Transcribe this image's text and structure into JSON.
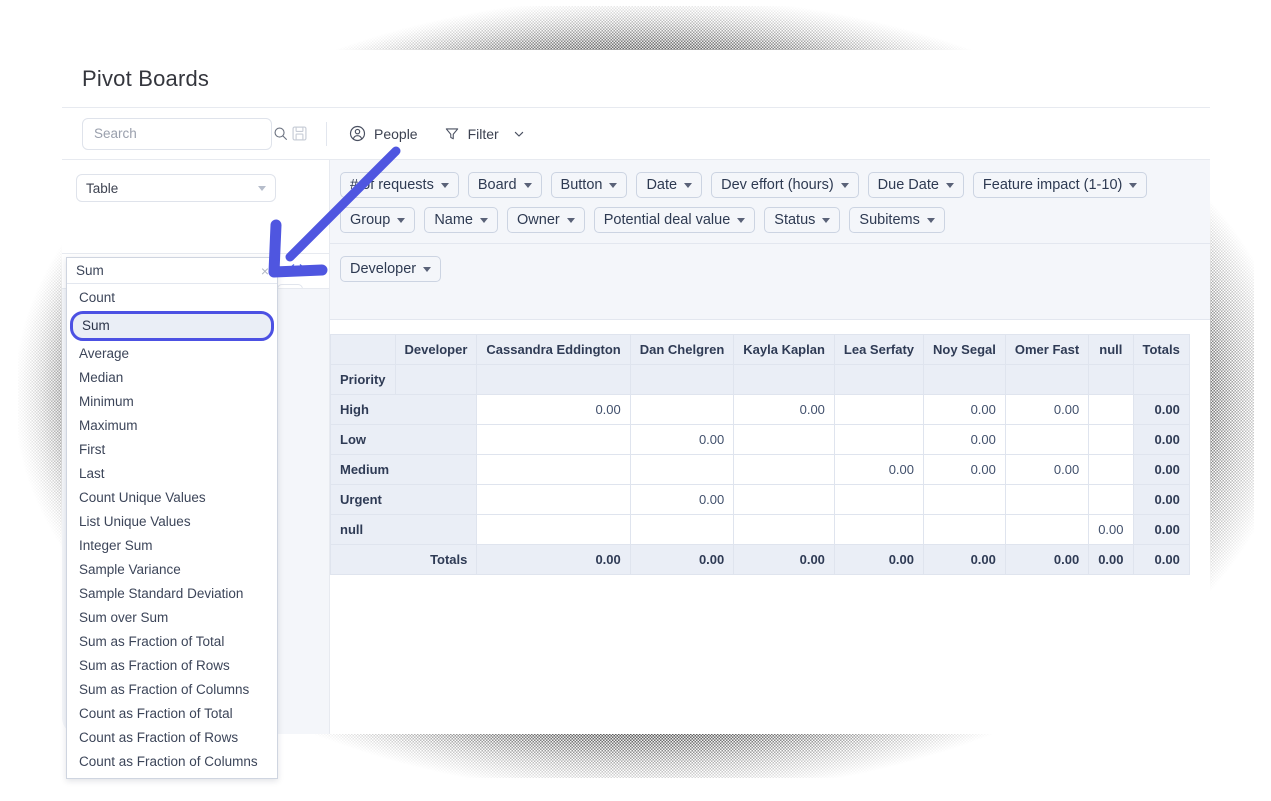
{
  "window": {
    "title": "Pivot Boards"
  },
  "toolbar": {
    "search": {
      "placeholder": "Search",
      "value": "",
      "icon": "search-icon"
    },
    "save_icon": "save-floppy-icon",
    "people": {
      "label": "People",
      "icon": "person-circle-icon"
    },
    "filter": {
      "label": "Filter",
      "icon": "funnel-icon",
      "caret": "chevron-down-icon"
    }
  },
  "left_pane": {
    "renderer_select": {
      "value": "Table",
      "caret": "chevron-down-icon"
    },
    "sort_icons": [
      "sort-down-icon",
      "arrows-horizontal-icon"
    ],
    "mini_select_caret": "chevron-down-icon"
  },
  "aggregator_dropdown": {
    "input_value": "Sum",
    "clear_icon": "close-x-icon",
    "selected": "Sum",
    "options": [
      "Count",
      "Sum",
      "Average",
      "Median",
      "Minimum",
      "Maximum",
      "First",
      "Last",
      "Count Unique Values",
      "List Unique Values",
      "Integer Sum",
      "Sample Variance",
      "Sample Standard Deviation",
      "Sum over Sum",
      "Sum as Fraction of Total",
      "Sum as Fraction of Rows",
      "Sum as Fraction of Columns",
      "Count as Fraction of Total",
      "Count as Fraction of Rows",
      "Count as Fraction of Columns"
    ]
  },
  "field_chips": {
    "row_one": [
      "# of requests",
      "Board",
      "Button",
      "Date",
      "Dev effort (hours)",
      "Due Date",
      "Feature impact (1-10)"
    ],
    "row_two": [
      "Group",
      "Name",
      "Owner",
      "Potential deal value",
      "Status",
      "Subitems"
    ],
    "row_three": [
      "Developer"
    ]
  },
  "pivot_table": {
    "column_axis_label": "Developer",
    "row_axis_label": "Priority",
    "column_headers": [
      "Cassandra Eddington",
      "Dan Chelgren",
      "Kayla Kaplan",
      "Lea Serfaty",
      "Noy Segal",
      "Omer Fast",
      "null"
    ],
    "totals_label": "Totals",
    "rows": [
      {
        "label": "High",
        "values": [
          "0.00",
          "",
          "0.00",
          "",
          "0.00",
          "0.00",
          ""
        ],
        "total": "0.00"
      },
      {
        "label": "Low",
        "values": [
          "",
          "0.00",
          "",
          "",
          "0.00",
          "",
          ""
        ],
        "total": "0.00"
      },
      {
        "label": "Medium",
        "values": [
          "",
          "",
          "",
          "0.00",
          "0.00",
          "0.00",
          ""
        ],
        "total": "0.00"
      },
      {
        "label": "Urgent",
        "values": [
          "",
          "0.00",
          "",
          "",
          "",
          "",
          ""
        ],
        "total": "0.00"
      },
      {
        "label": "null",
        "values": [
          "",
          "",
          "",
          "",
          "",
          "",
          "0.00"
        ],
        "total": "0.00"
      }
    ],
    "totals_row": {
      "label": "Totals",
      "values": [
        "0.00",
        "0.00",
        "0.00",
        "0.00",
        "0.00",
        "0.00",
        "0.00"
      ],
      "total": "0.00"
    }
  },
  "annotation": {
    "type": "arrow",
    "color": "#4f56e0",
    "points": "from top-right to bottom-left pointing at aggregator dropdown"
  },
  "colors": {
    "accent": "#4c51e3",
    "chip_border": "#ccd4e2",
    "panel_bg": "#f4f6fa",
    "table_header_bg": "#eaeef6",
    "text": "#2f3b55"
  }
}
